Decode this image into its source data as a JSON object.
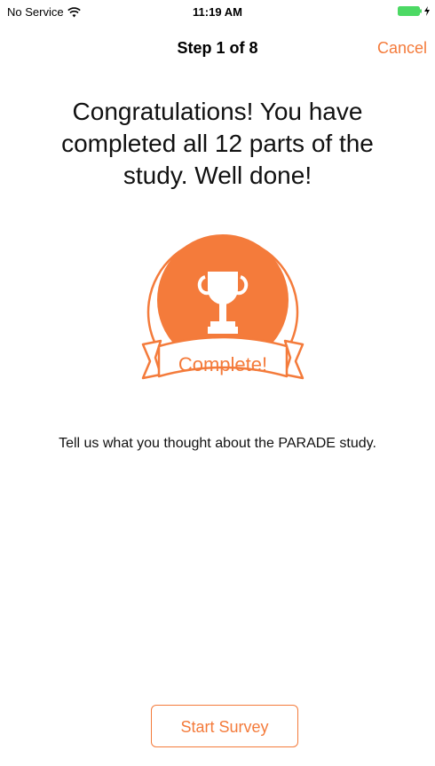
{
  "status_bar": {
    "carrier": "No Service",
    "time": "11:19 AM",
    "icons": [
      "wifi-icon",
      "battery-icon",
      "charging-icon"
    ]
  },
  "nav": {
    "title": "Step 1 of 8",
    "cancel_label": "Cancel"
  },
  "content": {
    "headline": "Congratulations! You have completed all 12 parts of the study. Well done!",
    "badge": {
      "icon": "trophy-icon",
      "label": "Complete!"
    },
    "body_text": "Tell us what you thought about the PARADE study."
  },
  "actions": {
    "start_survey_label": "Start Survey"
  },
  "colors": {
    "accent": "#f47b3b"
  }
}
